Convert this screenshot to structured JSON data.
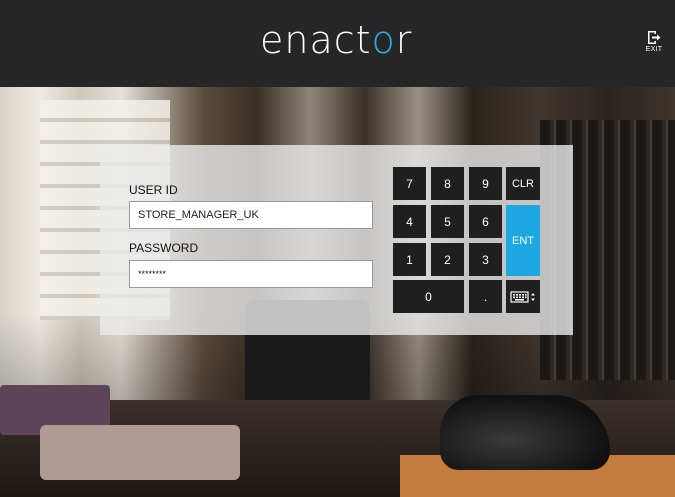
{
  "header": {
    "logo_text_pre": "enact",
    "logo_text_o": "o",
    "logo_text_post": "r",
    "exit_label": "EXIT"
  },
  "login": {
    "user_id_label": "USER ID",
    "user_id_value": "STORE_MANAGER_UK",
    "password_label": "PASSWORD",
    "password_value": "********"
  },
  "keypad": {
    "k7": "7",
    "k8": "8",
    "k9": "9",
    "clr": "CLR",
    "k4": "4",
    "k5": "5",
    "k6": "6",
    "ent": "ENT",
    "k1": "1",
    "k2": "2",
    "k3": "3",
    "k0": "0",
    "dot": "."
  },
  "colors": {
    "header_bg": "#262626",
    "accent": "#1ea8e1",
    "key_bg": "#1f1f1f"
  },
  "icons": [
    "exit-icon",
    "keyboard-icon"
  ]
}
